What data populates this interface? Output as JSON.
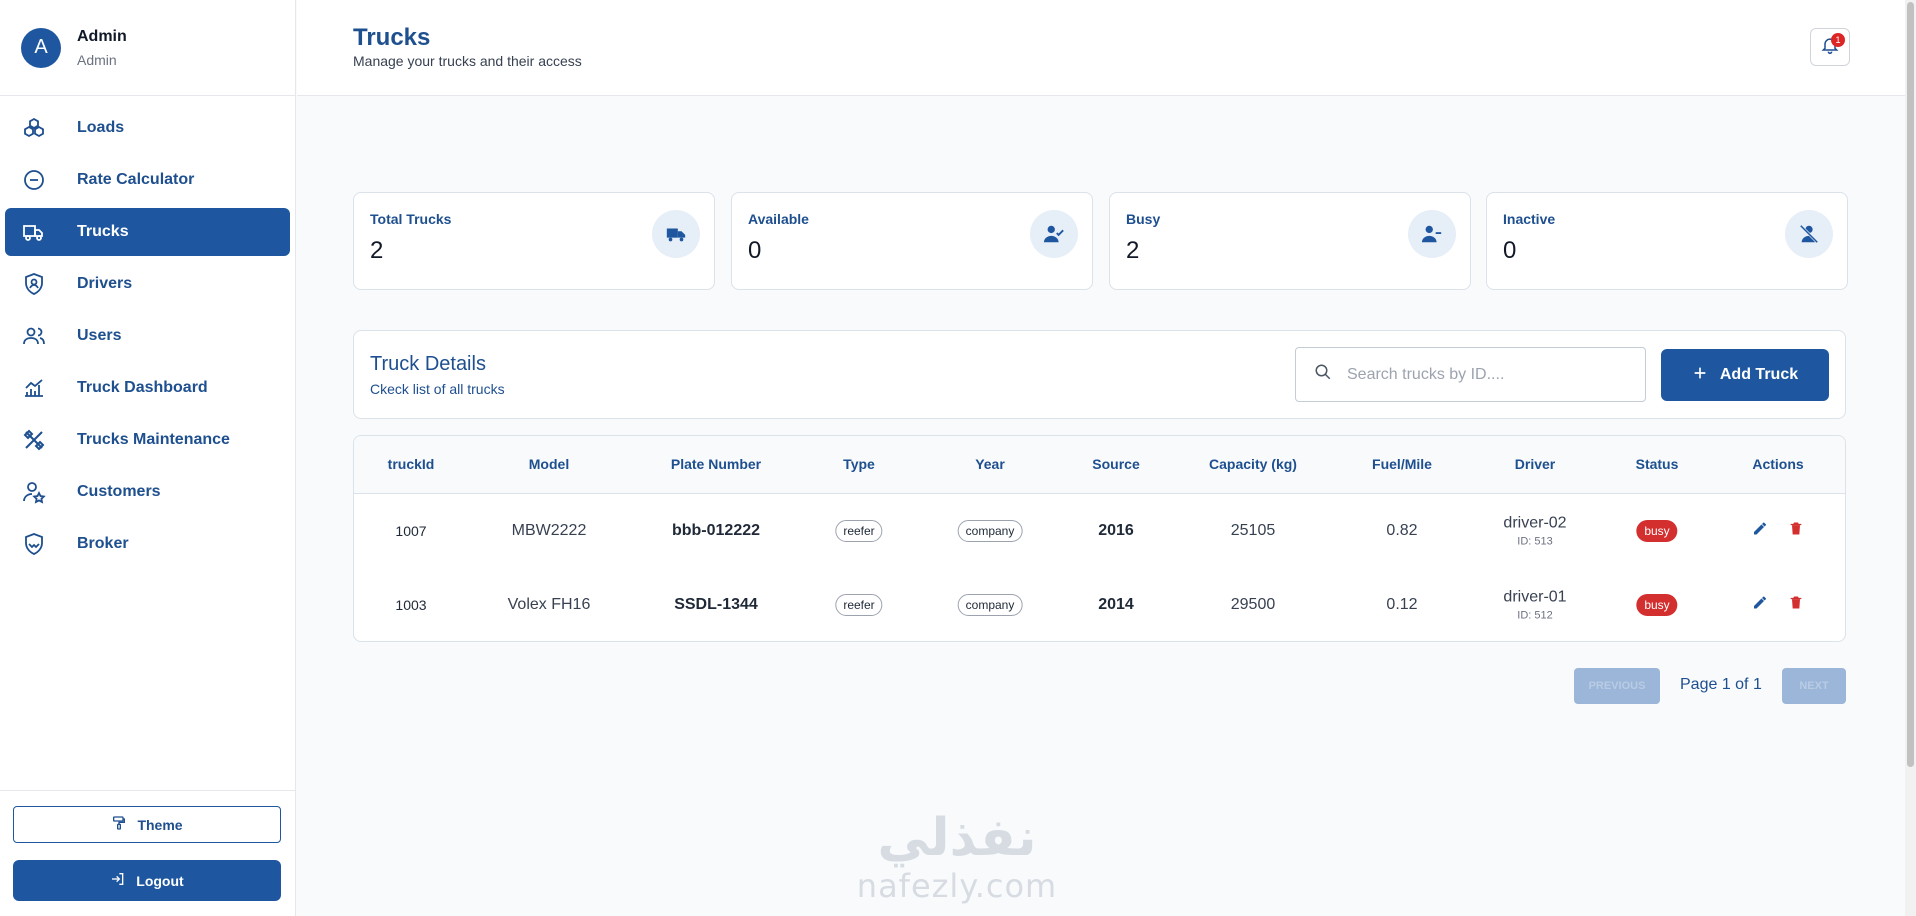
{
  "user": {
    "avatar_letter": "A",
    "name": "Admin",
    "role": "Admin"
  },
  "sidebar": {
    "items": [
      {
        "label": "Loads",
        "icon": "cubes-icon",
        "active": false
      },
      {
        "label": "Rate Calculator",
        "icon": "minus-circle-icon",
        "active": false
      },
      {
        "label": "Trucks",
        "icon": "truck-icon",
        "active": true
      },
      {
        "label": "Drivers",
        "icon": "shield-user-icon",
        "active": false
      },
      {
        "label": "Users",
        "icon": "users-icon",
        "active": false
      },
      {
        "label": "Truck Dashboard",
        "icon": "chart-icon",
        "active": false
      },
      {
        "label": "Trucks Maintenance",
        "icon": "tools-icon",
        "active": false
      },
      {
        "label": "Customers",
        "icon": "user-star-icon",
        "active": false
      },
      {
        "label": "Broker",
        "icon": "handshake-icon",
        "active": false
      }
    ],
    "theme_label": "Theme",
    "logout_label": "Logout"
  },
  "header": {
    "title": "Trucks",
    "subtitle": "Manage your trucks and their access",
    "notification_count": "1"
  },
  "stats": [
    {
      "label": "Total Trucks",
      "value": "2",
      "icon": "truck-icon"
    },
    {
      "label": "Available",
      "value": "0",
      "icon": "user-check-icon"
    },
    {
      "label": "Busy",
      "value": "2",
      "icon": "user-minus-icon"
    },
    {
      "label": "Inactive",
      "value": "0",
      "icon": "user-off-icon"
    }
  ],
  "panel": {
    "title": "Truck Details",
    "subtitle": "Ckeck list of all trucks",
    "search_placeholder": "Search trucks by ID....",
    "add_label": "Add Truck"
  },
  "table": {
    "columns": [
      "truckId",
      "Model",
      "Plate Number",
      "Type",
      "Year",
      "Source",
      "Capacity (kg)",
      "Fuel/Mile",
      "Driver",
      "Status",
      "Actions"
    ],
    "rows": [
      {
        "truckId": "1007",
        "model": "MBW2222",
        "plate": "bbb-012222",
        "type": "reefer",
        "year": "company",
        "source": "2016",
        "capacity": "25105",
        "fuel": "0.82",
        "driver": "driver-02",
        "driver_id": "ID: 513",
        "status": "busy"
      },
      {
        "truckId": "1003",
        "model": "Volex FH16",
        "plate": "SSDL-1344",
        "type": "reefer",
        "year": "company",
        "source": "2014",
        "capacity": "29500",
        "fuel": "0.12",
        "driver": "driver-01",
        "driver_id": "ID: 512",
        "status": "busy"
      }
    ]
  },
  "pagination": {
    "prev_label": "PREVIOUS",
    "page_text": "Page 1 of 1",
    "next_label": "NEXT"
  },
  "watermark": {
    "arabic": "نفذلي",
    "latin": "nafezly.com"
  },
  "colors": {
    "primary": "#1e57a0",
    "danger": "#d32f2f"
  }
}
